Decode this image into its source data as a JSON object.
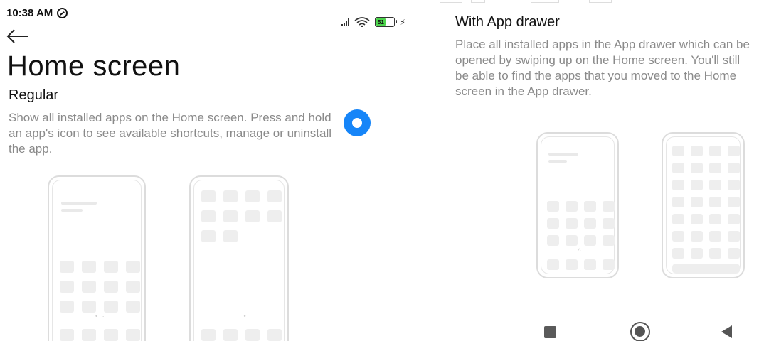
{
  "status_bar": {
    "time": "10:38 AM",
    "battery_level": "51",
    "battery_percent": 51
  },
  "left": {
    "title": "Home screen",
    "option": {
      "title": "Regular",
      "description": "Show all installed apps on the Home screen. Press and hold an app's icon to see available shortcuts, manage or uninstall the app.",
      "selected": true
    }
  },
  "right": {
    "option": {
      "title": "With App drawer",
      "description": "Place all installed apps in the App drawer which can be opened by swiping up on the Home screen. You'll still be able to find the apps that you moved to the Home screen in the App drawer.",
      "selected": false
    }
  },
  "nav_bar": {
    "buttons": [
      "recents",
      "home",
      "back"
    ]
  },
  "colors": {
    "accent": "#1685f8",
    "text_primary": "#111111",
    "text_secondary": "#8a8a8a",
    "battery": "#4cd44c",
    "mockup_tile": "#eeeeee",
    "mockup_border": "#dcdcdc"
  },
  "icons": {
    "status": [
      "do-not-disturb-icon",
      "signal-icon",
      "wifi-icon",
      "battery-icon",
      "charging-icon"
    ],
    "navigation": [
      "back-arrow-icon",
      "recents-icon",
      "home-icon",
      "nav-back-icon"
    ]
  }
}
